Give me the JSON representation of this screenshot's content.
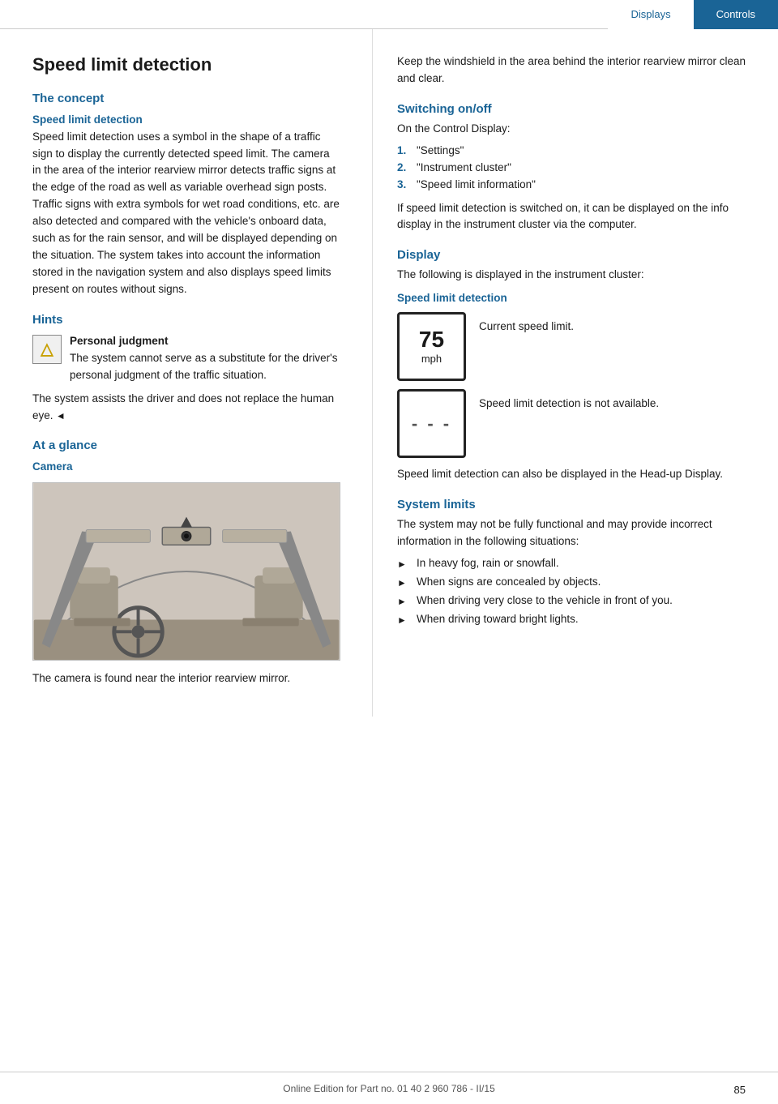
{
  "nav": {
    "tab_displays": "Displays",
    "tab_controls": "Controls"
  },
  "page": {
    "title": "Speed limit detection",
    "left_col": {
      "concept_heading": "The concept",
      "speed_limit_subheading": "Speed limit detection",
      "body_paragraph": "Speed limit detection uses a symbol in the shape of a traffic sign to display the currently detected speed limit. The camera in the area of the interior rearview mirror detects traffic signs at the edge of the road as well as variable overhead sign posts. Traffic signs with extra symbols for wet road conditions, etc. are also detected and compared with the vehicle's onboard data, such as for the rain sensor, and will be displayed depending on the situation. The system takes into account the information stored in the navigation system and also displays speed limits present on routes without signs.",
      "hints_heading": "Hints",
      "hint_title": "Personal judgment",
      "hint_body": "The system cannot serve as a substitute for the driver's personal judgment of the traffic situation.",
      "hint_extra": "The system assists the driver and does not replace the human eye.",
      "at_a_glance_heading": "At a glance",
      "camera_subheading": "Camera",
      "camera_caption": "The camera is found near the interior rearview mirror."
    },
    "right_col": {
      "intro_text": "Keep the windshield in the area behind the interior rearview mirror clean and clear.",
      "switching_heading": "Switching on/off",
      "switching_intro": "On the Control Display:",
      "steps": [
        {
          "num": "1.",
          "text": "\"Settings\""
        },
        {
          "num": "2.",
          "text": "\"Instrument cluster\""
        },
        {
          "num": "3.",
          "text": "\"Speed limit information\""
        }
      ],
      "steps_note": "If speed limit detection is switched on, it can be displayed on the info display in the instrument cluster via the computer.",
      "display_heading": "Display",
      "display_intro": "The following is displayed in the instrument cluster:",
      "speed_limit_subheading": "Speed limit detection",
      "speed_limit_caption": "Current speed limit.",
      "speed_value": "75",
      "speed_unit": "mph",
      "dashes": "- - -",
      "speed_unavail_caption": "Speed limit detection is not available.",
      "head_up_note": "Speed limit detection can also be displayed in the Head-up Display.",
      "system_limits_heading": "System limits",
      "system_limits_intro": "The system may not be fully functional and may provide incorrect information in the following situations:",
      "bullets": [
        "In heavy fog, rain or snowfall.",
        "When signs are concealed by objects.",
        "When driving very close to the vehicle in front of you.",
        "When driving toward bright lights."
      ]
    }
  },
  "footer": {
    "text": "Online Edition for Part no. 01 40 2 960 786 - II/15",
    "page_number": "85"
  }
}
